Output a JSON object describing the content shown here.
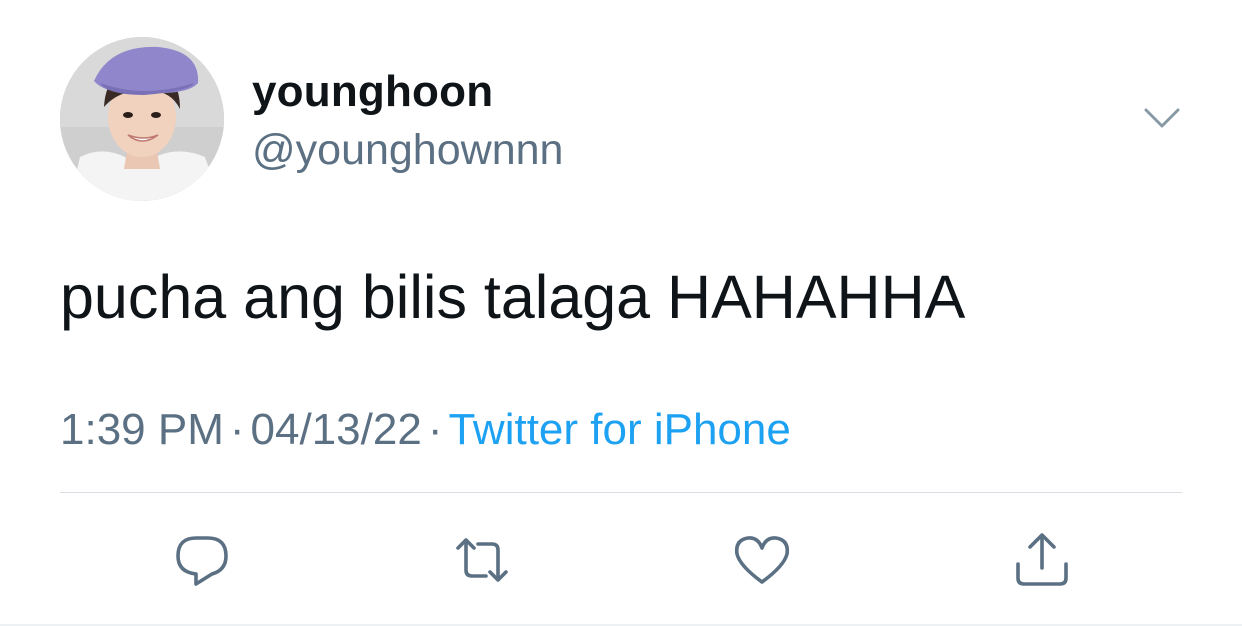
{
  "tweet": {
    "display_name": "younghoon",
    "handle": "@younghownnn",
    "text": "pucha ang bilis talaga HAHAHHA",
    "time": "1:39 PM",
    "date": "04/13/22",
    "separator": "·",
    "source": "Twitter for iPhone"
  },
  "icons": {
    "caret": "chevron-down-icon",
    "reply": "reply-icon",
    "retweet": "retweet-icon",
    "like": "heart-icon",
    "share": "share-icon"
  },
  "colors": {
    "text": "#0f1419",
    "secondary": "#5b7083",
    "link": "#1da1f2",
    "icon": "#5b7083",
    "divider": "#d8dee3"
  }
}
